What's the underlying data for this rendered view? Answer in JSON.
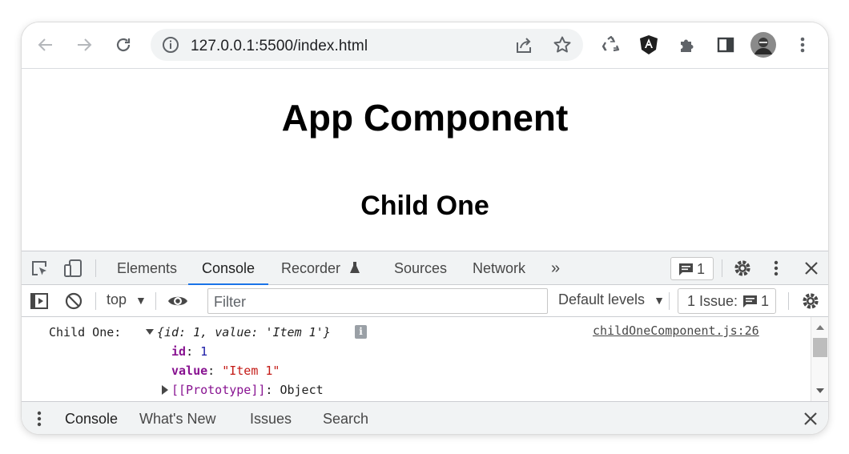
{
  "browser": {
    "url": "127.0.0.1:5500/index.html",
    "icons": [
      "back-arrow-icon",
      "forward-arrow-icon",
      "reload-icon",
      "info-icon",
      "share-icon",
      "star-icon",
      "recycle-extension-icon",
      "angular-extension-icon",
      "puzzle-extensions-icon",
      "side-panel-icon",
      "avatar",
      "more-vertical-icon"
    ]
  },
  "page": {
    "heading": "App Component",
    "subheading": "Child One"
  },
  "devtools": {
    "tabs": {
      "elements": "Elements",
      "console": "Console",
      "recorder": "Recorder",
      "sources": "Sources",
      "network": "Network",
      "more": "»"
    },
    "messages_count": "1",
    "filterbar": {
      "context": "top",
      "filter_placeholder": "Filter",
      "levels": "Default levels",
      "issue_label": "1 Issue:",
      "issue_count": "1"
    },
    "console": {
      "log_label": "Child One:",
      "object_summary": "{id: 1, value: 'Item 1'}",
      "info_badge": "i",
      "source_link": "childOneComponent.js:26",
      "props": [
        {
          "key": "id",
          "sep": ": ",
          "value": "1"
        },
        {
          "key": "value",
          "sep": ": ",
          "value": "\"Item 1\""
        }
      ],
      "prototype_key": "[[Prototype]]",
      "prototype_value": ": Object"
    },
    "drawer": {
      "tabs": [
        "Console",
        "What's New",
        "Issues",
        "Search"
      ]
    },
    "colors": {
      "accent": "#1a73e8",
      "link": "#5f6368",
      "key_purple": "#881391"
    }
  }
}
